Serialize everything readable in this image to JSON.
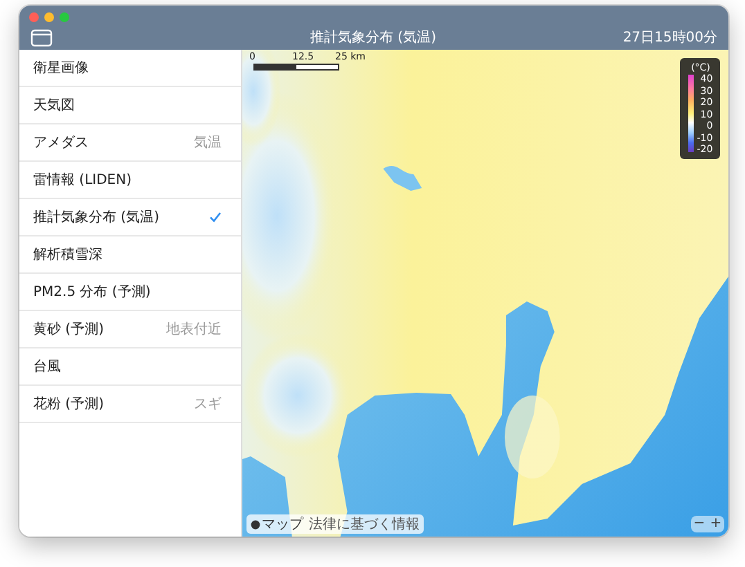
{
  "window": {
    "title": "推計気象分布 (気温)",
    "time": "27日15時00分"
  },
  "sidebar": {
    "items": [
      {
        "label": "衛星画像",
        "selected": false
      },
      {
        "label": "天気図",
        "selected": false
      },
      {
        "label": "アメダス",
        "value": "気温",
        "selected": false
      },
      {
        "label": "雷情報 (LIDEN)",
        "selected": false
      },
      {
        "label": "推計気象分布 (気温)",
        "selected": true
      },
      {
        "label": "解析積雪深",
        "selected": false
      },
      {
        "label": "PM2.5 分布 (予測)",
        "selected": false
      },
      {
        "label": "黄砂 (予測)",
        "value": "地表付近",
        "selected": false
      },
      {
        "label": "台風",
        "selected": false
      },
      {
        "label": "花粉 (予測)",
        "value": "スギ",
        "selected": false
      }
    ]
  },
  "map": {
    "scale": {
      "ticks": [
        "0",
        "12.5",
        "25 km"
      ]
    },
    "legend": {
      "unit": "(°C)",
      "ticks": [
        "40",
        "30",
        "20",
        "10",
        "0",
        "-10",
        "-20"
      ]
    },
    "attribution": {
      "brand": "マップ",
      "legal": "法律に基づく情報"
    },
    "zoom_controls": [
      "−",
      "+"
    ]
  }
}
